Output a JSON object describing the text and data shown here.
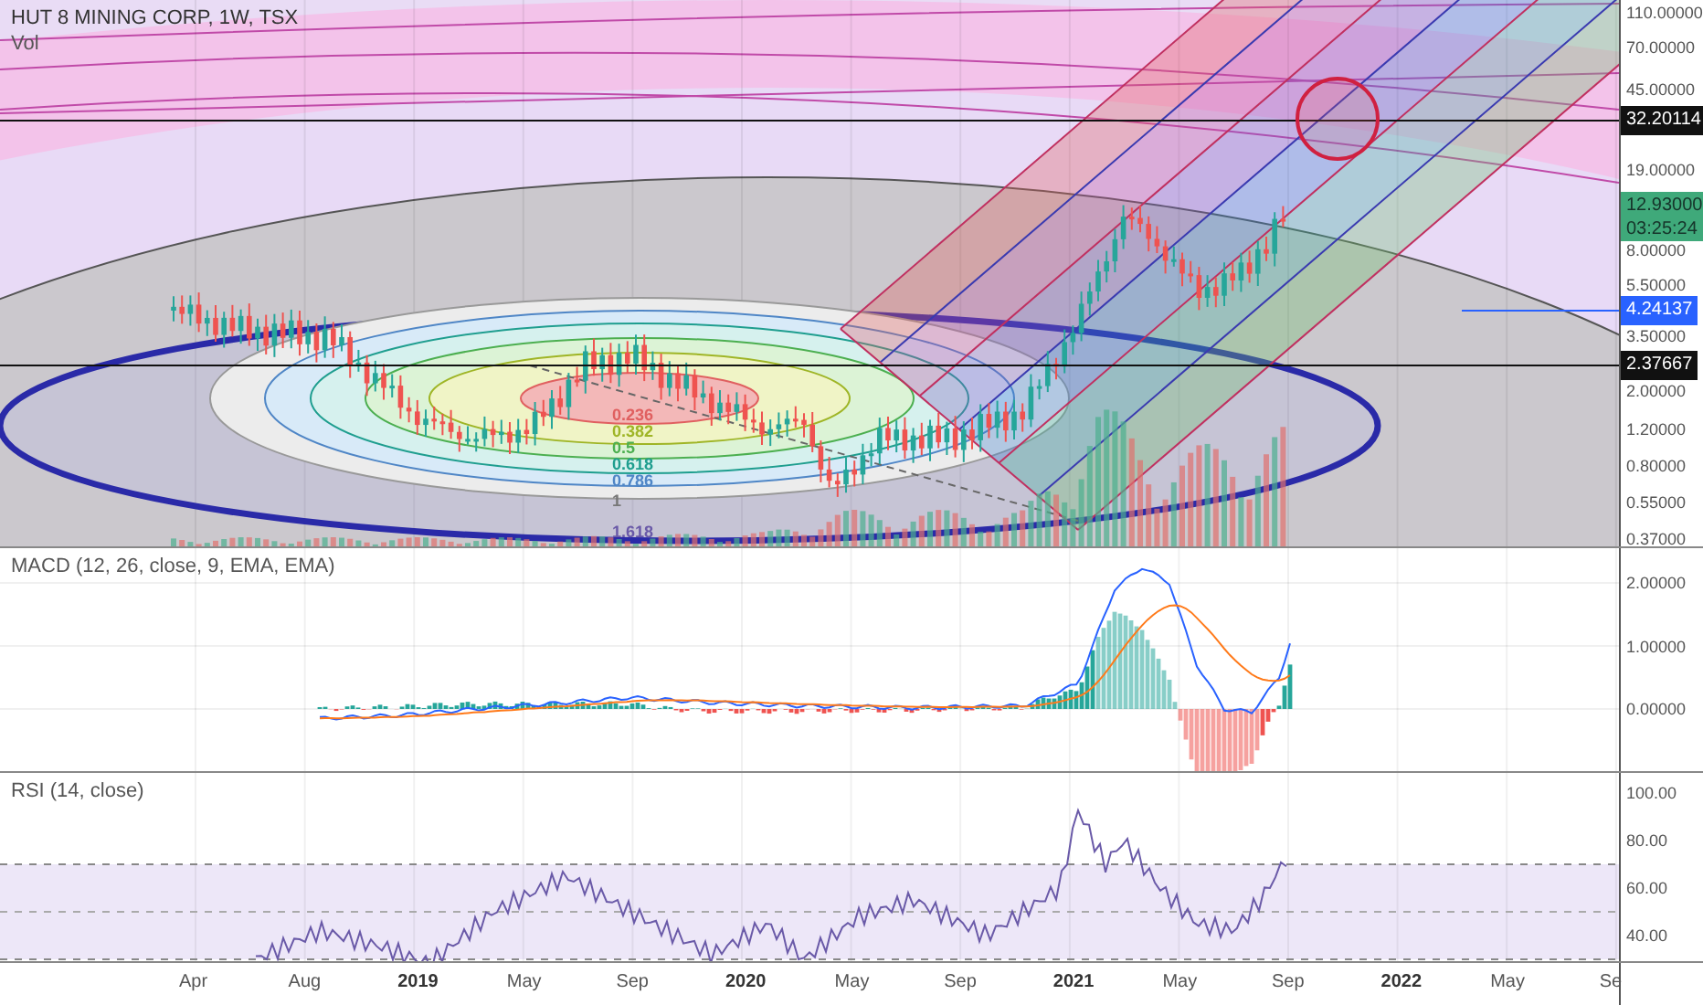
{
  "chart": {
    "title": "HUT 8 MINING CORP, 1W, TSX",
    "volume_label": "Vol",
    "price_axis": [
      "110.00000",
      "70.00000",
      "45.00000",
      "19.00000",
      "8.00000",
      "5.50000",
      "3.50000",
      "2.00000",
      "1.20000",
      "0.80000",
      "0.55000",
      "0.37000"
    ],
    "price_markers": [
      {
        "kind": "dark",
        "label": "32.20114"
      },
      {
        "kind": "last",
        "label": "12.93000",
        "countdown": "03:25:24"
      },
      {
        "kind": "line",
        "label": "4.24137"
      },
      {
        "kind": "dark",
        "label": "2.37667"
      }
    ],
    "fib_levels": [
      {
        "label": "0.236",
        "color": "#e06060"
      },
      {
        "label": "0.382",
        "color": "#9fb526"
      },
      {
        "label": "0.5",
        "color": "#4caf50"
      },
      {
        "label": "0.618",
        "color": "#1f9e8f"
      },
      {
        "label": "0.786",
        "color": "#4f86c6"
      },
      {
        "label": "1",
        "color": "#777777"
      },
      {
        "label": "1.618",
        "color": "#6a5aa8"
      }
    ]
  },
  "macd": {
    "title": "MACD (12, 26, close, 9, EMA, EMA)",
    "axis": [
      "2.00000",
      "1.00000",
      "0.00000"
    ]
  },
  "rsi": {
    "title": "RSI (14, close)",
    "axis": [
      "100.00",
      "80.00",
      "60.00",
      "40.00"
    ]
  },
  "time_axis": [
    {
      "label": "Apr",
      "kind": "month"
    },
    {
      "label": "Aug",
      "kind": "month"
    },
    {
      "label": "2019",
      "kind": "year"
    },
    {
      "label": "May",
      "kind": "month"
    },
    {
      "label": "Sep",
      "kind": "month"
    },
    {
      "label": "2020",
      "kind": "year"
    },
    {
      "label": "May",
      "kind": "month"
    },
    {
      "label": "Sep",
      "kind": "month"
    },
    {
      "label": "2021",
      "kind": "year"
    },
    {
      "label": "May",
      "kind": "month"
    },
    {
      "label": "Sep",
      "kind": "month"
    },
    {
      "label": "2022",
      "kind": "year"
    },
    {
      "label": "May",
      "kind": "month"
    },
    {
      "label": "Se",
      "kind": "month"
    }
  ]
}
